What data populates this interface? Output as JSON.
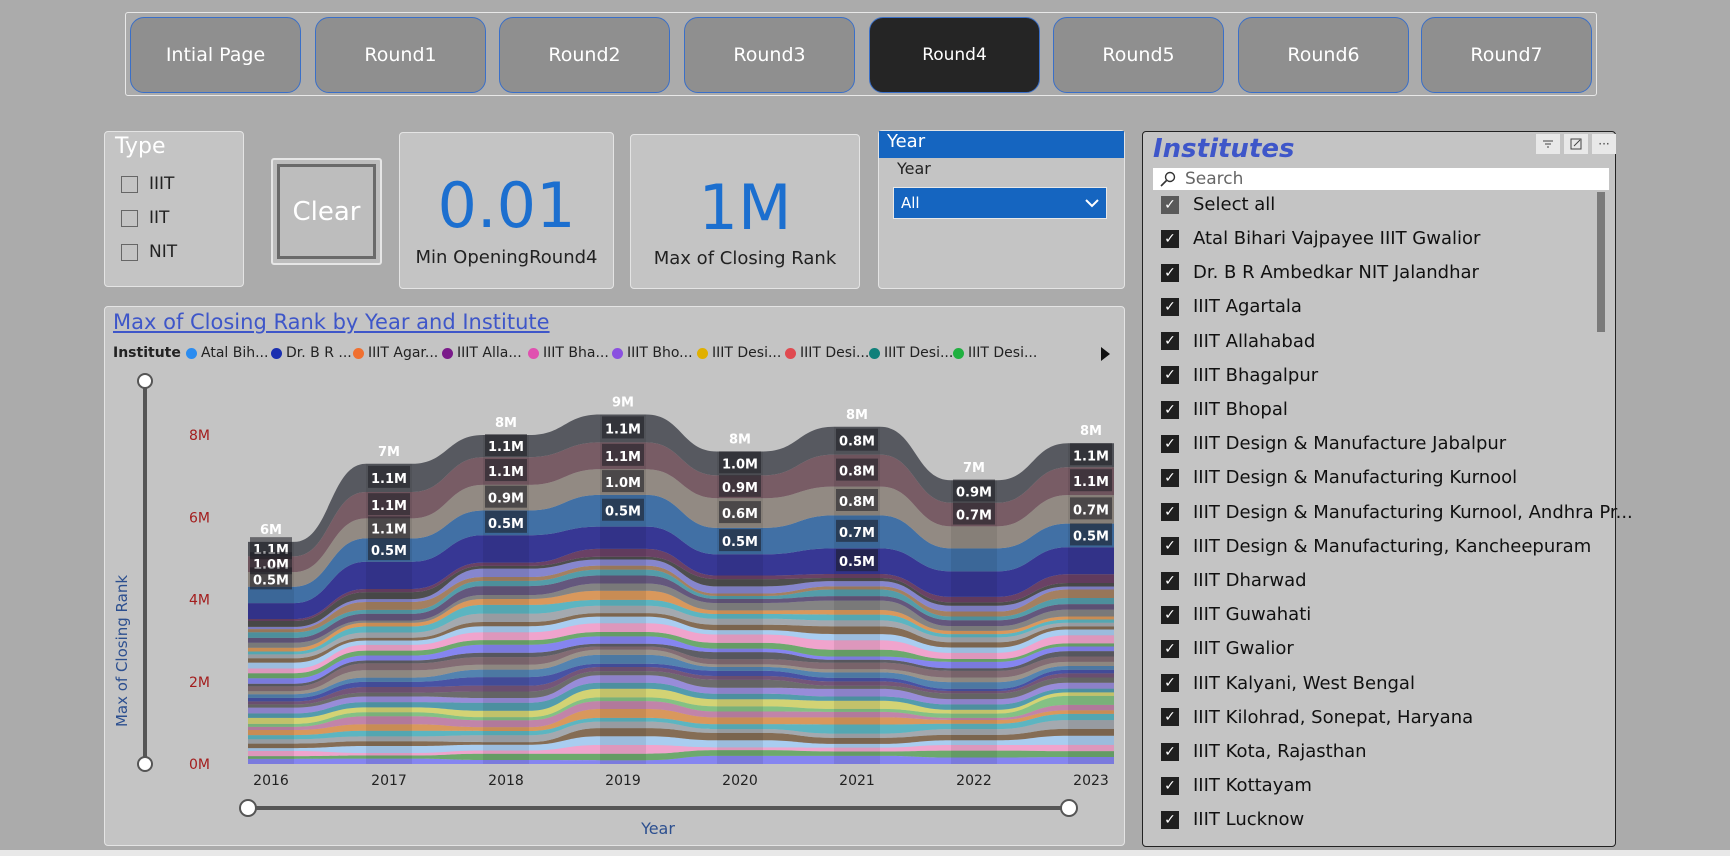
{
  "nav": {
    "buttons": [
      "Intial Page",
      "Round1",
      "Round2",
      "Round3",
      "Round4",
      "Round5",
      "Round6",
      "Round7"
    ],
    "active": "Round4"
  },
  "type_slicer": {
    "title": "Type",
    "options": [
      "IIIT",
      "IIT",
      "NIT"
    ]
  },
  "clear_button": "Clear",
  "kpi1": {
    "value": "0.01",
    "label": "Min  OpeningRound4"
  },
  "kpi2": {
    "value": "1M",
    "label": "Max of Closing Rank"
  },
  "year_slicer": {
    "header": "Year",
    "label": "Year",
    "selected": "All"
  },
  "chart_data": {
    "type": "area",
    "title": "Max of Closing Rank by Year and Institute",
    "xlabel": "Year",
    "ylabel": "Max of Closing Rank",
    "legend_title": "Institute",
    "legend": [
      {
        "name": "Atal Bih...",
        "color": "#2b8cf0"
      },
      {
        "name": "Dr. B R ...",
        "color": "#1a2fb0"
      },
      {
        "name": "IIIT Agar...",
        "color": "#f07030"
      },
      {
        "name": "IIIT Alla...",
        "color": "#7a1a8a"
      },
      {
        "name": "IIIT Bha...",
        "color": "#e050b0"
      },
      {
        "name": "IIIT Bho...",
        "color": "#8a50e0"
      },
      {
        "name": "IIIT Desi...",
        "color": "#e0b000"
      },
      {
        "name": "IIIT Desi...",
        "color": "#e04a50"
      },
      {
        "name": "IIIT Desi...",
        "color": "#10807a"
      },
      {
        "name": "IIIT Desi...",
        "color": "#20b040"
      }
    ],
    "y_ticks": [
      "0M",
      "2M",
      "4M",
      "6M",
      "8M"
    ],
    "ylim": [
      0,
      9400000
    ],
    "categories": [
      "2016",
      "2017",
      "2018",
      "2019",
      "2020",
      "2021",
      "2022",
      "2023"
    ],
    "totals": [
      5.4,
      7.3,
      8.0,
      8.5,
      7.6,
      8.2,
      6.9,
      7.8
    ],
    "total_labels": [
      "6M",
      "7M",
      "8M",
      "9M",
      "8M",
      "8M",
      "7M",
      "8M"
    ],
    "series_colors": [
      "#44464f",
      "#6b4a55",
      "#8a8078",
      "#2a62a0",
      "#1e1e8c",
      "#5a2a55",
      "#3a3a3a",
      "#7b7bd0",
      "#9a6a40",
      "#2f8fa0",
      "#443366",
      "#6f6f6f"
    ],
    "top_labels": [
      [
        "1.1M",
        "1.0M",
        "0.5M"
      ],
      [
        "1.1M",
        "1.1M",
        "1.1M",
        "0.5M"
      ],
      [
        "1.1M",
        "1.1M",
        "0.9M",
        "0.5M"
      ],
      [
        "1.1M",
        "1.1M",
        "1.0M",
        "0.5M"
      ],
      [
        "1.0M",
        "0.9M",
        "0.6M",
        "0.5M"
      ],
      [
        "0.8M",
        "0.8M",
        "0.8M",
        "0.7M",
        "0.5M"
      ],
      [
        "0.9M",
        "0.7M"
      ],
      [
        "1.1M",
        "1.1M",
        "0.7M",
        "0.5M"
      ]
    ]
  },
  "institutes": {
    "title": "Institutes",
    "search_placeholder": "Search",
    "select_all": "Select all",
    "items": [
      "Atal Bihari Vajpayee IIIT Gwalior",
      "Dr. B R Ambedkar NIT Jalandhar",
      "IIIT Agartala",
      "IIIT Allahabad",
      "IIIT Bhagalpur",
      "IIIT Bhopal",
      "IIIT Design & Manufacture Jabalpur",
      "IIIT Design & Manufacturing Kurnool",
      "IIIT Design & Manufacturing Kurnool, Andhra Pr...",
      "IIIT Design & Manufacturing, Kancheepuram",
      "IIIT Dharwad",
      "IIIT Guwahati",
      "IIIT Gwalior",
      "IIIT Kalyani, West Bengal",
      "IIIT Kilohrad, Sonepat, Haryana",
      "IIIT Kota, Rajasthan",
      "IIIT Kottayam",
      "IIIT Lucknow"
    ]
  }
}
